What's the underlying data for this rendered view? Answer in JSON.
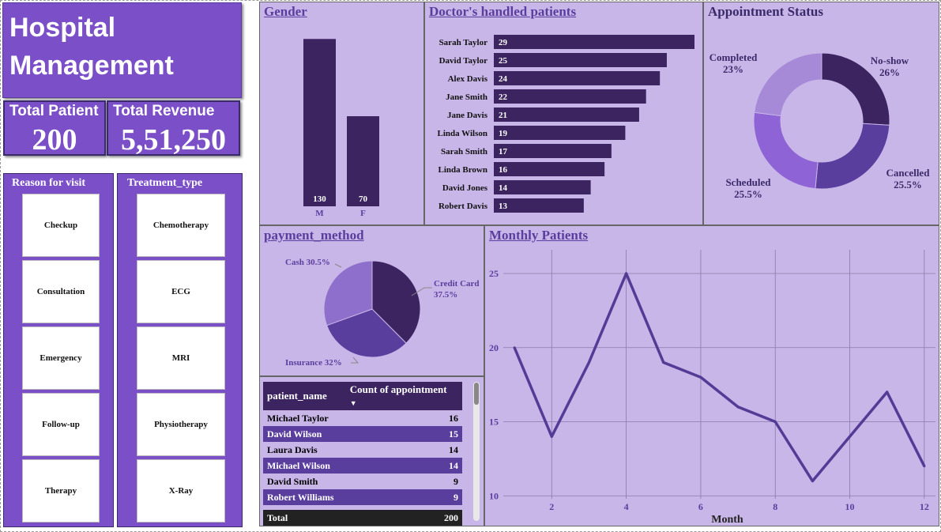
{
  "header": {
    "line1": "Hospital",
    "line2": "Management"
  },
  "kpis": {
    "patients_label": "Total Patient",
    "patients_value": "200",
    "revenue_label": "Total Revenue",
    "revenue_value": "5,51,250"
  },
  "reason": {
    "title": "Reason for visit",
    "items": [
      "Checkup",
      "Consultation",
      "Emergency",
      "Follow-up",
      "Therapy"
    ]
  },
  "treatment": {
    "title": "Treatment_type",
    "items": [
      "Chemotherapy",
      "ECG",
      "MRI",
      "Physiotherapy",
      "X-Ray"
    ]
  },
  "colors": {
    "accent": "#7b4fc8",
    "panel": "#c9b6e8",
    "dark": "#3b2460",
    "mid": "#5a3e9e",
    "light": "#a68ad8",
    "violet": "#8e63d6"
  },
  "chart_data": [
    {
      "id": "gender",
      "type": "bar",
      "title": "Gender",
      "categories": [
        "M",
        "F"
      ],
      "values": [
        130,
        70
      ],
      "ylim": [
        0,
        140
      ]
    },
    {
      "id": "doctors",
      "type": "bar",
      "orientation": "horizontal",
      "title": "Doctor's handled patients",
      "categories": [
        "Sarah Taylor",
        "David Taylor",
        "Alex Davis",
        "Jane Smith",
        "Jane Davis",
        "Linda Wilson",
        "Sarah Smith",
        "Linda Brown",
        "David Jones",
        "Robert Davis"
      ],
      "values": [
        29,
        25,
        24,
        22,
        21,
        19,
        17,
        16,
        14,
        13
      ],
      "xlim": [
        0,
        29
      ]
    },
    {
      "id": "appointment",
      "type": "pie",
      "style": "donut",
      "title": "Appointment Status",
      "labels": [
        "No-show",
        "Cancelled",
        "Scheduled",
        "Completed"
      ],
      "values": [
        26,
        25.5,
        25.5,
        23
      ],
      "value_labels": [
        "26%",
        "25.5%",
        "25.5%",
        "23%"
      ],
      "colors": [
        "#3b2460",
        "#5a3e9e",
        "#8e63d6",
        "#a68ad8"
      ]
    },
    {
      "id": "payment",
      "type": "pie",
      "title": "payment_method",
      "labels": [
        "Credit Card",
        "Insurance",
        "Cash"
      ],
      "values": [
        37.5,
        32,
        30.5
      ],
      "value_labels": [
        "37.5%",
        "32%",
        "30.5%"
      ],
      "colors": [
        "#3b2460",
        "#5a3e9e",
        "#8e70cc"
      ]
    },
    {
      "id": "monthly",
      "type": "line",
      "title": "Monthly Patients",
      "xlabel": "Month",
      "ylabel": "",
      "x": [
        1,
        2,
        3,
        4,
        5,
        6,
        7,
        8,
        9,
        10,
        11,
        12
      ],
      "y": [
        20,
        14,
        19,
        25,
        19,
        18,
        16,
        15,
        11,
        14,
        17,
        12
      ],
      "xticks": [
        2,
        4,
        6,
        8,
        10,
        12
      ],
      "yticks": [
        10,
        15,
        20,
        25
      ],
      "xlim": [
        0.7,
        12.3
      ],
      "ylim": [
        9.8,
        26.6
      ],
      "grid": true
    }
  ],
  "patients_table": {
    "headers": [
      "patient_name",
      "Count of appointment"
    ],
    "rows": [
      [
        "Michael Taylor",
        "16"
      ],
      [
        "David Wilson",
        "15"
      ],
      [
        "Laura Davis",
        "14"
      ],
      [
        "Michael Wilson",
        "14"
      ],
      [
        "David Smith",
        "9"
      ],
      [
        "Robert Williams",
        "9"
      ]
    ],
    "total_label": "Total",
    "total_value": "200"
  }
}
